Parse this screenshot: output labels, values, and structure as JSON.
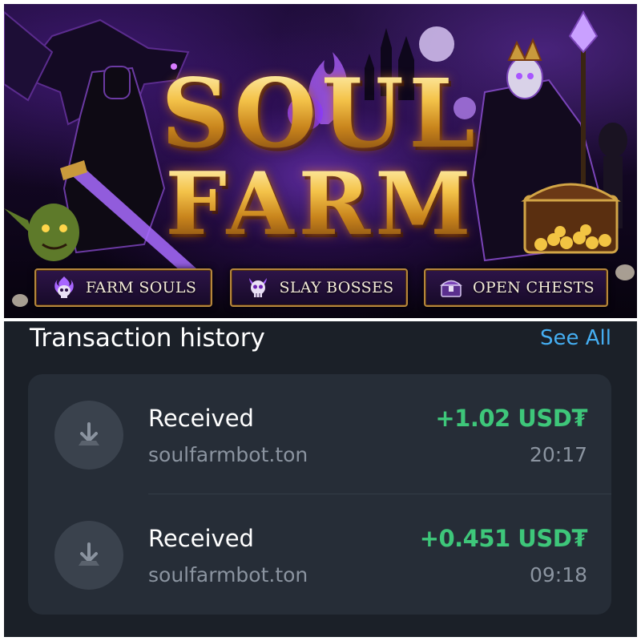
{
  "banner": {
    "logo_line1": "SOUL",
    "logo_line2": "FARM",
    "buttons": [
      {
        "label": "FARM SOULS",
        "icon": "flaming-skull-icon"
      },
      {
        "label": "SLAY BOSSES",
        "icon": "horned-skull-icon"
      },
      {
        "label": "OPEN CHESTS",
        "icon": "treasure-chest-icon"
      }
    ],
    "colors": {
      "gold": "#f4c34a",
      "purple_glow": "#9646ff",
      "frame": "#b6873c"
    }
  },
  "wallet": {
    "title": "Transaction history",
    "see_all_label": "See All",
    "transactions": [
      {
        "kind": "Received",
        "address": "soulfarmbot.ton",
        "amount": "+1.02 USD₮",
        "time": "20:17",
        "icon": "download-arrow-icon"
      },
      {
        "kind": "Received",
        "address": "soulfarmbot.ton",
        "amount": "+0.451 USD₮",
        "time": "09:18",
        "icon": "download-arrow-icon"
      }
    ],
    "colors": {
      "background": "#1b2028",
      "card": "#262d37",
      "amount_green": "#3ec77a",
      "link_blue": "#45aef2"
    }
  }
}
